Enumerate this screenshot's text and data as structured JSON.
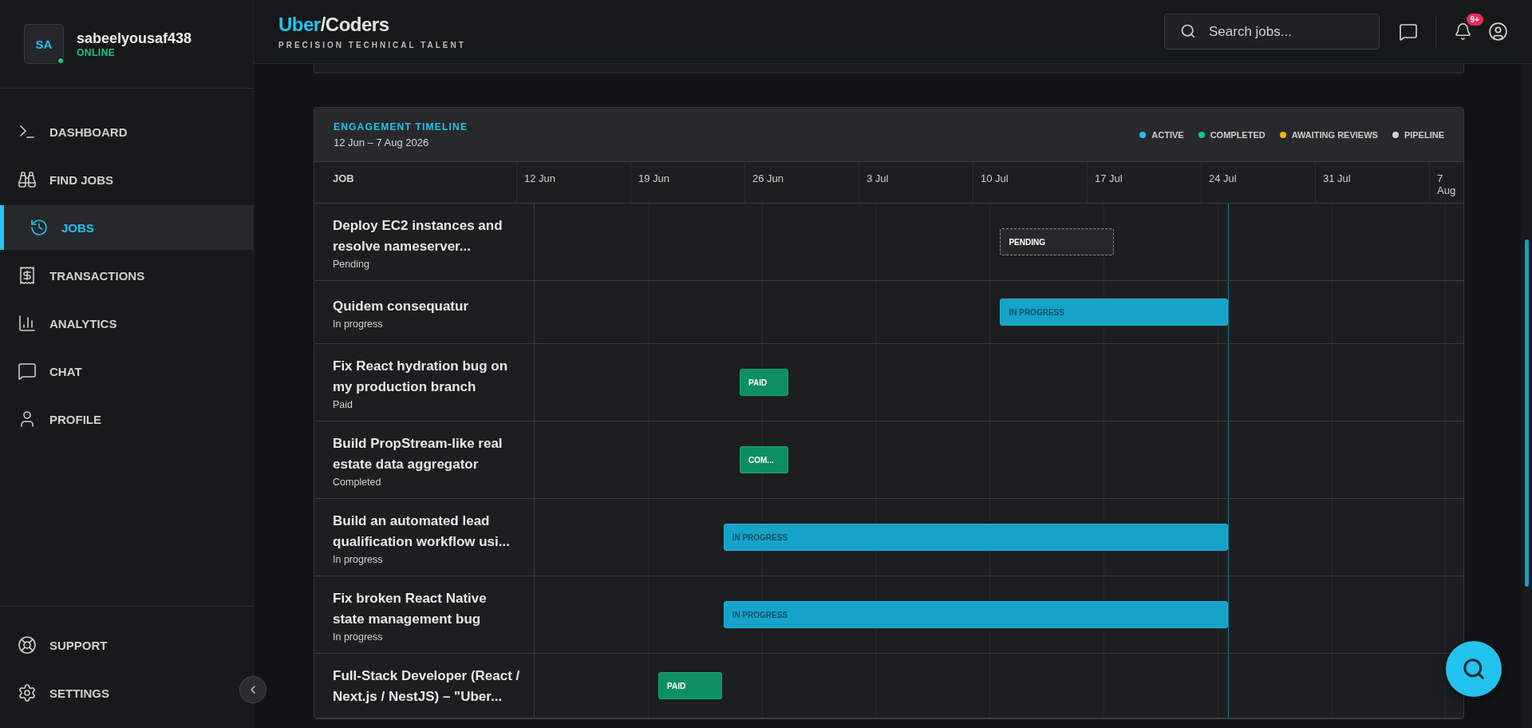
{
  "sidebar": {
    "user": {
      "initials": "SA",
      "name": "sabeelyousaf438",
      "status": "ONLINE",
      "online": true
    },
    "nav": [
      {
        "label": "DASHBOARD",
        "selected": false
      },
      {
        "label": "FIND JOBS",
        "selected": false
      },
      {
        "label": "JOBS",
        "selected": true
      },
      {
        "label": "TRANSACTIONS",
        "selected": false
      },
      {
        "label": "ANALYTICS",
        "selected": false
      },
      {
        "label": "CHAT",
        "selected": false
      },
      {
        "label": "PROFILE",
        "selected": false
      }
    ],
    "footer": [
      {
        "label": "SUPPORT"
      },
      {
        "label": "SETTINGS"
      }
    ]
  },
  "header": {
    "logo": {
      "accent": "Uber",
      "rest": "/Coders"
    },
    "tagline": "PRECISION TECHNICAL TALENT",
    "search": {
      "placeholder": "Search jobs..."
    },
    "notifications_badge": "9+"
  },
  "timeline": {
    "title": "ENGAGEMENT TIMELINE",
    "range": "12 Jun – 7 Aug 2026",
    "legend": [
      {
        "label": "ACTIVE",
        "color": "#22c3ee"
      },
      {
        "label": "COMPLETED",
        "color": "#10c98a"
      },
      {
        "label": "AWAITING REVIEWS",
        "color": "#f5b60b"
      },
      {
        "label": "PIPELINE",
        "color": "#d0d0d0"
      }
    ],
    "job_column": "JOB",
    "dates": [
      "12 Jun",
      "19 Jun",
      "26 Jun",
      "3 Jul",
      "10 Jul",
      "17 Jul",
      "24 Jul",
      "31 Jul",
      "7 Aug"
    ],
    "rows": [
      {
        "title": "Deploy EC2 instances and resolve nameserver...",
        "status": "Pending",
        "bar": {
          "kind": "pending",
          "label": "PENDING"
        }
      },
      {
        "title": "Quidem consequatur",
        "status": "In progress",
        "bar": {
          "kind": "active",
          "label": "IN PROGRESS"
        }
      },
      {
        "title": "Fix React hydration bug on my production branch",
        "status": "Paid",
        "bar": {
          "kind": "completed",
          "label": "PAID"
        }
      },
      {
        "title": "Build PropStream-like real estate data aggregator",
        "status": "Completed",
        "bar": {
          "kind": "completed",
          "label": "COM..."
        }
      },
      {
        "title": "Build an automated lead qualification workflow usi...",
        "status": "In progress",
        "bar": {
          "kind": "active",
          "label": "IN PROGRESS"
        }
      },
      {
        "title": "Fix broken React Native state management bug",
        "status": "In progress",
        "bar": {
          "kind": "active",
          "label": "IN PROGRESS"
        }
      },
      {
        "title": "Full-Stack Developer (React / Next.js / NestJS) – \"Uber...",
        "bar": {
          "kind": "completed",
          "label": "PAID"
        }
      }
    ]
  }
}
